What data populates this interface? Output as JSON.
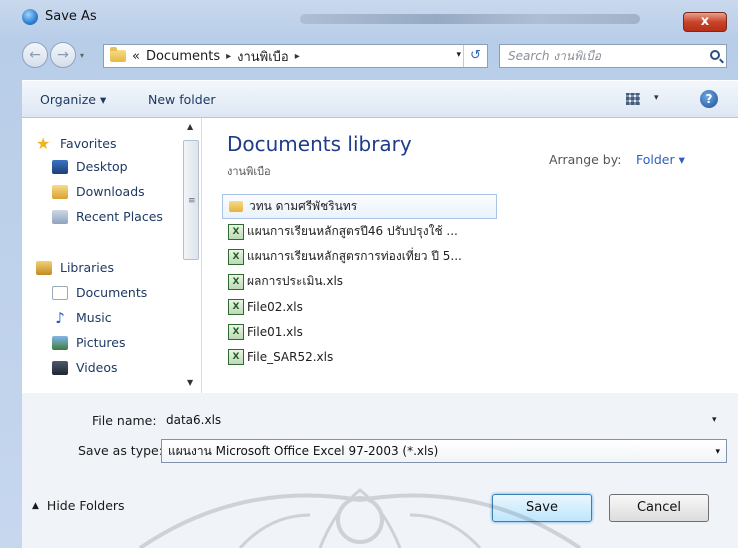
{
  "window": {
    "title": "Save As",
    "close_label": "x"
  },
  "address": {
    "crumbs": [
      "«",
      "Documents",
      "▸",
      "งานพิเบือ",
      "▸"
    ],
    "search_placeholder": "Search งานพิเบือ"
  },
  "toolbar": {
    "organize": "Organize ▾",
    "new_folder": "New folder",
    "views_dd": "▾",
    "help": "?"
  },
  "nav": {
    "favorites": "Favorites",
    "favorites_items": [
      "Desktop",
      "Downloads",
      "Recent Places"
    ],
    "libraries": "Libraries",
    "libraries_items": [
      "Documents",
      "Music",
      "Pictures",
      "Videos"
    ]
  },
  "content": {
    "title": "Documents library",
    "subtitle": "งานพิเบือ",
    "arrange_label": "Arrange by:",
    "arrange_value": "Folder ▾",
    "files": [
      "วทน ดามศรีพัชรินทร",
      "แผนการเรียนหลักสูตรปี46  ปรับปรุงใช้ ...",
      "แผนการเรียนหลักสูตรการท่องเที่ยว ปี 5...",
      "ผลการประเมิน.xls",
      "File02.xls",
      "File01.xls",
      "File_SAR52.xls"
    ]
  },
  "form": {
    "file_name_label": "File name:",
    "file_name_value": "data6.xls",
    "save_as_type_label": "Save as type:",
    "save_as_type_value": "แผนงาน Microsoft Office Excel 97-2003 (*.xls)"
  },
  "footer": {
    "hide_folders": "Hide Folders",
    "save": "Save",
    "cancel": "Cancel"
  },
  "icons": {
    "app": "save-as-globe-icon",
    "folder": "folder-icon",
    "xls": "excel-file-icon",
    "search": "search-icon",
    "help": "help-icon",
    "views": "views-icon"
  }
}
